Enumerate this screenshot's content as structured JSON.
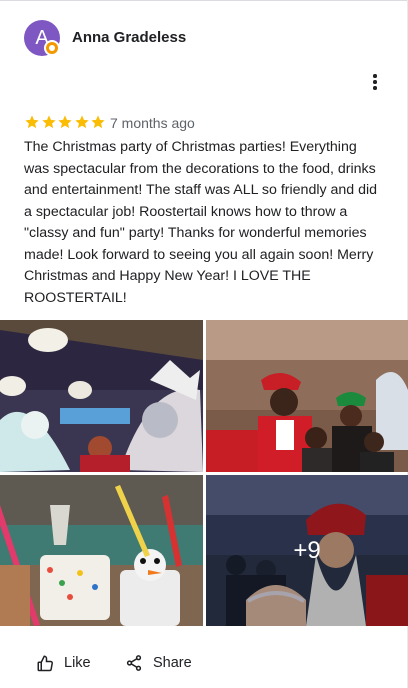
{
  "review": {
    "author": {
      "initial": "A",
      "name": "Anna Gradeless",
      "avatar_color": "#7e57c2"
    },
    "rating": 5,
    "age": "7 months ago",
    "text": "The Christmas party of Christmas parties! Everything was spectacular from the decorations to the food, drinks and entertainment! The staff was ALL so friendly and did a spectacular job! Roostertail knows how to throw a \"classy and fun\" party! Thanks for wonderful memories made! Look forward to seeing you all again soon! Merry Christmas and Happy New Year! I LOVE THE ROOSTERTAIL!",
    "star_color": "#fbbc04",
    "photos_more": "+9"
  },
  "actions": {
    "like_label": "Like",
    "share_label": "Share"
  },
  "icons": {
    "more": "more-vert-icon",
    "star": "star-icon",
    "like": "thumb-up-icon",
    "share": "share-icon",
    "badge": "local-guide-badge-icon"
  }
}
